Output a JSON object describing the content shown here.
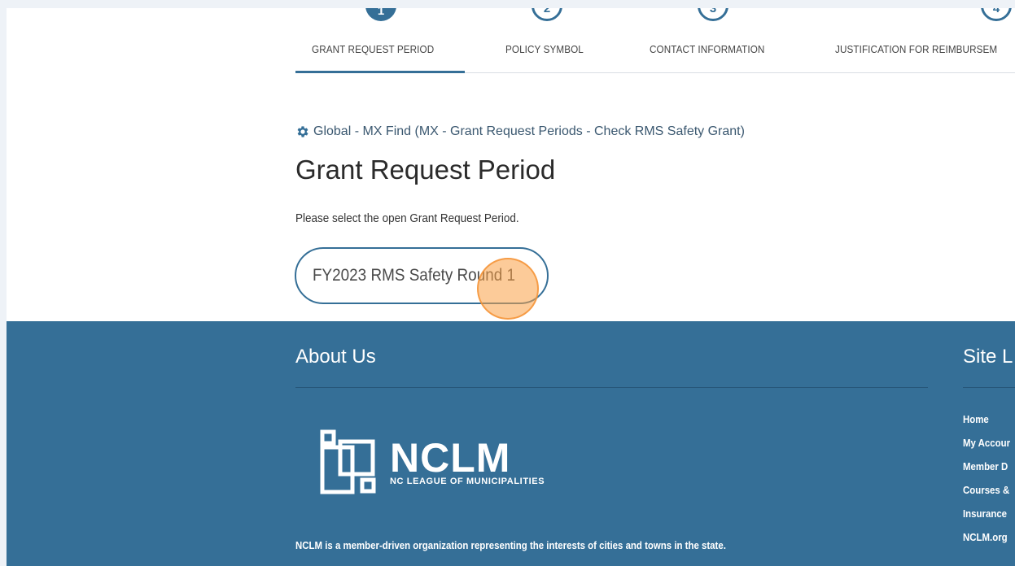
{
  "stepper": {
    "steps": [
      {
        "number": "1",
        "label": "GRANT REQUEST PERIOD"
      },
      {
        "number": "2",
        "label": "POLICY SYMBOL"
      },
      {
        "number": "3",
        "label": "CONTACT INFORMATION"
      },
      {
        "number": "4",
        "label": "JUSTIFICATION FOR REIMBURSEM"
      }
    ],
    "active_index": 0
  },
  "breadcrumb": {
    "icon": "gear-icon",
    "text": "Global - MX Find (MX - Grant Request Periods - Check RMS Safety Grant)"
  },
  "main": {
    "title": "Grant Request Period",
    "instructions": "Please select the open Grant Request Period.",
    "options": [
      {
        "label": "FY2023 RMS Safety Round 1"
      }
    ]
  },
  "footer": {
    "about": {
      "heading": "About Us",
      "logo_name": "NCLM",
      "logo_sub": "NC LEAGUE OF MUNICIPALITIES",
      "description": "NCLM is a member-driven organization representing the interests of cities and towns in the state."
    },
    "site_links": {
      "heading": "Site L",
      "items": [
        "Home",
        "My Accour",
        "Member D",
        "Courses &",
        "Insurance",
        "NCLM.org"
      ]
    }
  },
  "colors": {
    "primary": "#356f97",
    "click_marker": "#f9a04a"
  }
}
